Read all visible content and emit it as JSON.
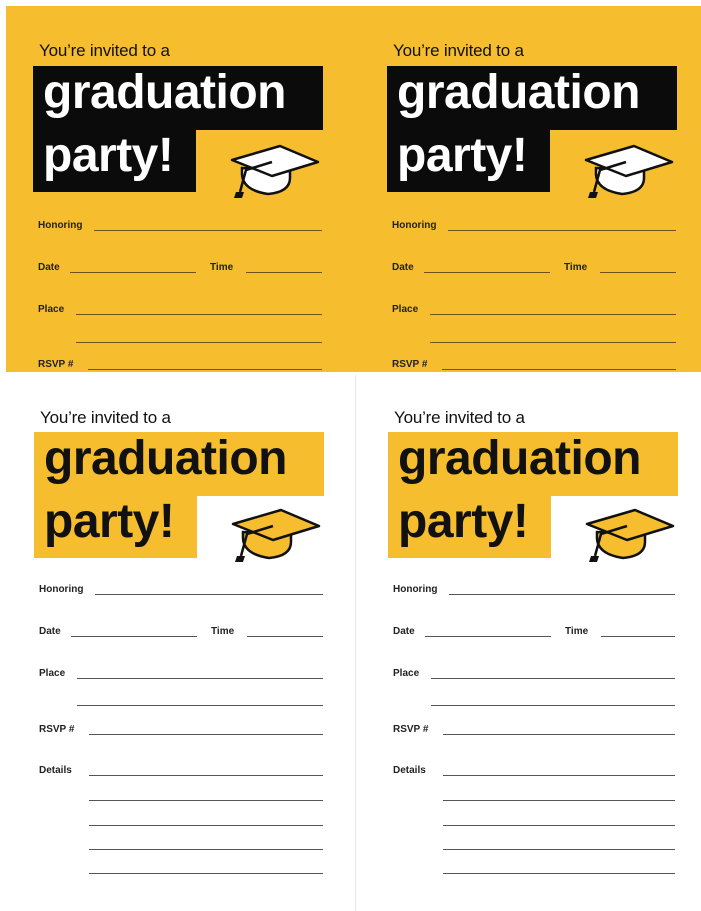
{
  "invitation": {
    "intro": "You’re invited to a",
    "headline_line1": "graduation",
    "headline_line2": "party!",
    "fields": {
      "honoring": "Honoring",
      "date": "Date",
      "time": "Time",
      "place": "Place",
      "rsvp": "RSVP #",
      "details": "Details"
    }
  },
  "colors": {
    "accent_yellow": "#f6bd2e",
    "black": "#0b0b0b",
    "white": "#ffffff"
  },
  "icons": [
    "graduation-cap-icon"
  ],
  "cards": [
    {
      "variant": "yellow"
    },
    {
      "variant": "yellow"
    },
    {
      "variant": "white"
    },
    {
      "variant": "white"
    }
  ]
}
